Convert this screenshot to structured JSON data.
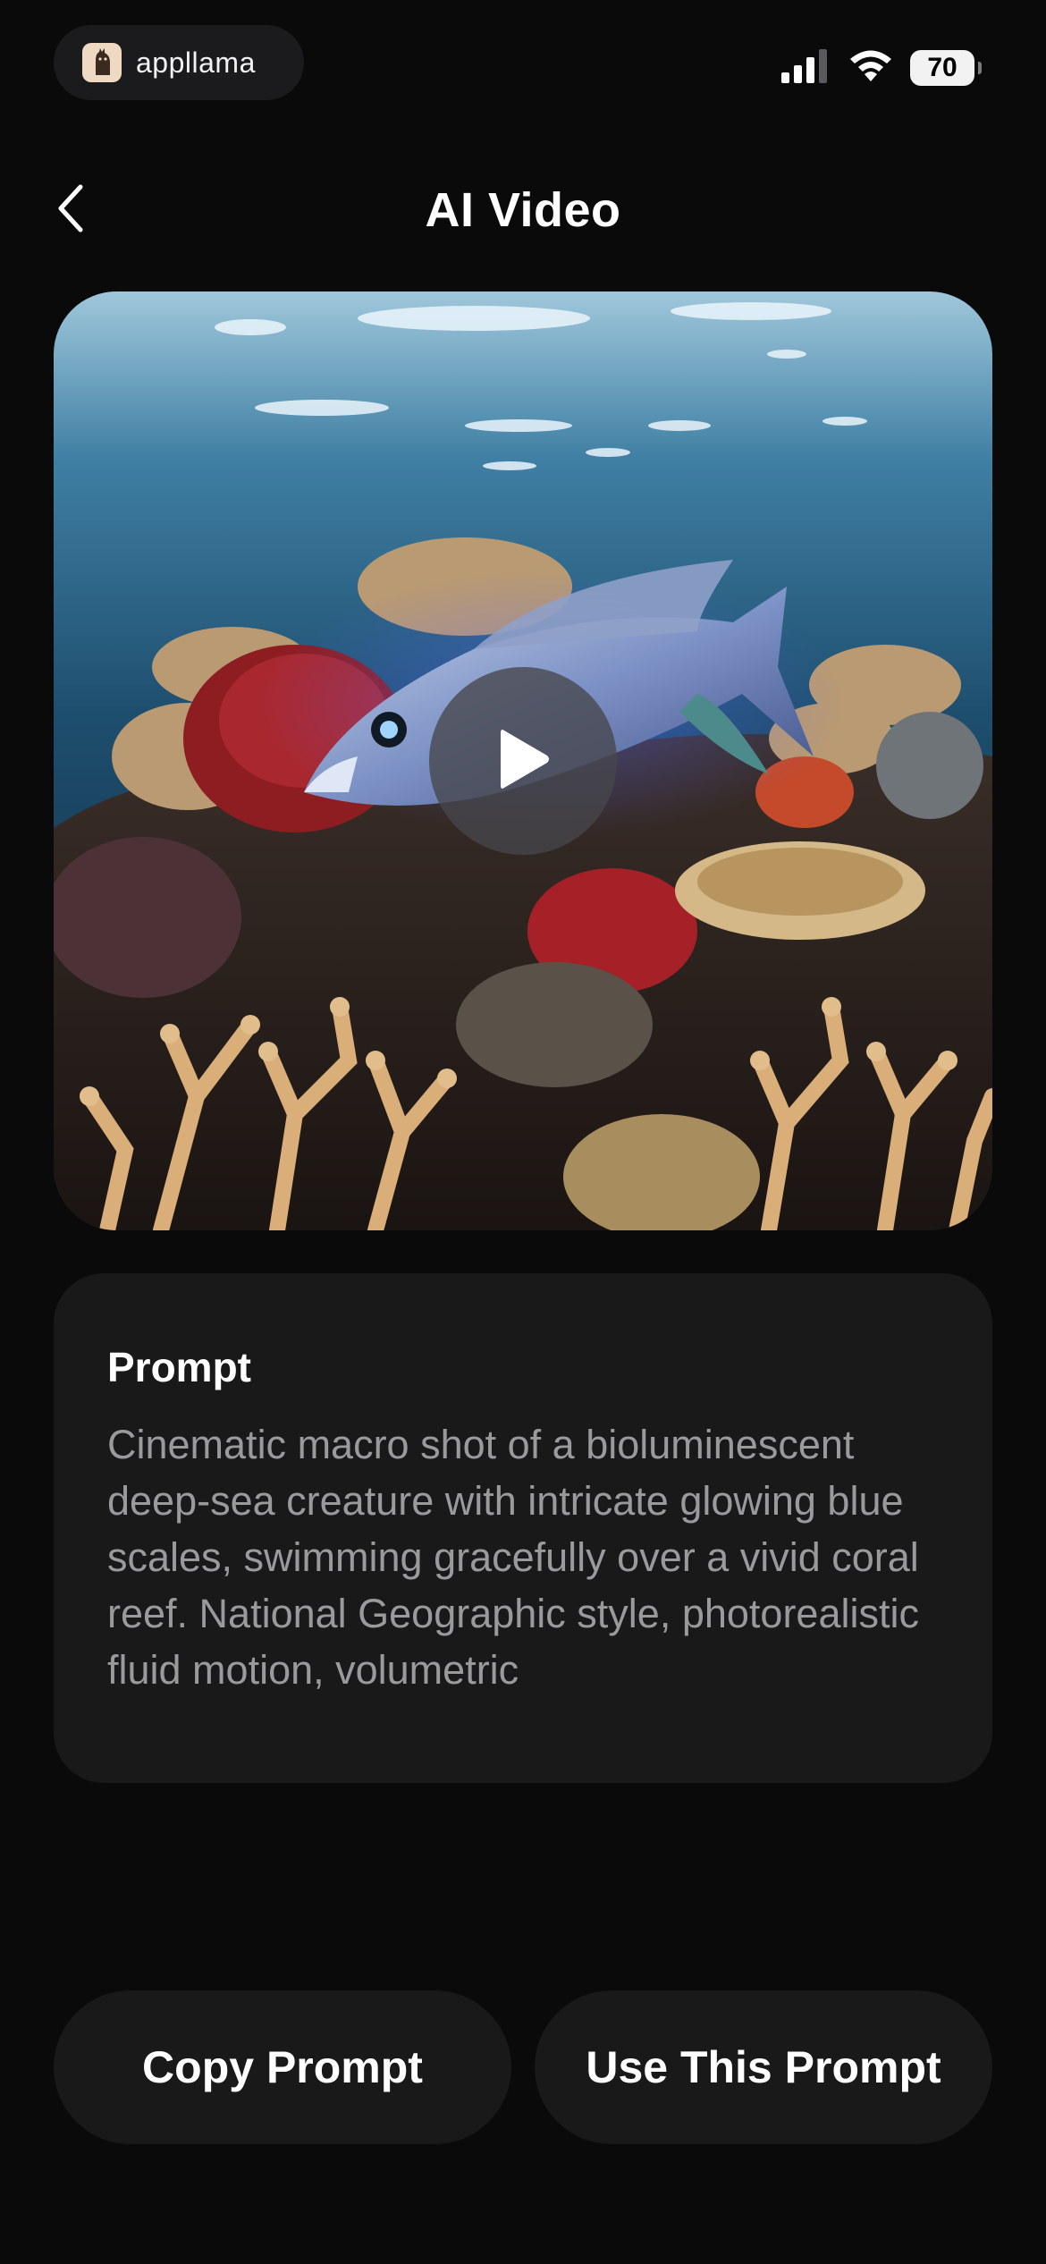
{
  "status_bar": {
    "brand": "appllama",
    "battery": "70",
    "icons": [
      "signal-icon",
      "wifi-icon",
      "battery-icon"
    ]
  },
  "header": {
    "title": "AI Video",
    "back_icon": "chevron-left-icon"
  },
  "video": {
    "thumbnail": "underwater-fish-coral-reef",
    "play_icon": "play-icon"
  },
  "prompt_card": {
    "label": "Prompt",
    "text": "Cinematic macro shot of a bioluminescent deep-sea creature with intricate glowing blue scales, swimming gracefully over a vivid coral reef. National Geographic style, photorealistic fluid motion, volumetric"
  },
  "actions": {
    "copy_label": "Copy Prompt",
    "use_label": "Use This Prompt"
  },
  "colors": {
    "background": "#0a0a0b",
    "card": "#19191a",
    "text_secondary": "#9a9a9c"
  }
}
